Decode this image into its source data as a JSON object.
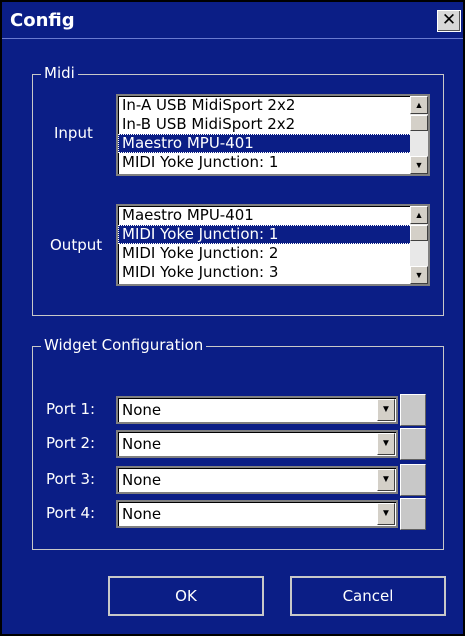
{
  "window": {
    "title": "Config",
    "close_glyph": "✕"
  },
  "midi": {
    "group_label": "Midi",
    "input_label": "Input",
    "output_label": "Output",
    "input_items": [
      "In-A USB MidiSport 2x2",
      "In-B USB MidiSport 2x2",
      "Maestro MPU-401",
      "MIDI Yoke Junction:  1"
    ],
    "input_selected_index": 2,
    "output_items": [
      "Maestro MPU-401",
      "MIDI Yoke Junction:  1",
      "MIDI Yoke Junction:  2",
      "MIDI Yoke Junction:  3"
    ],
    "output_selected_index": 1
  },
  "widget": {
    "group_label": "Widget Configuration",
    "ports": [
      {
        "label": "Port 1:",
        "value": "None"
      },
      {
        "label": "Port 2:",
        "value": "None"
      },
      {
        "label": "Port 3:",
        "value": "None"
      },
      {
        "label": "Port 4:",
        "value": "None"
      }
    ]
  },
  "buttons": {
    "ok": "OK",
    "cancel": "Cancel"
  },
  "icons": {
    "scroll_up": "up-arrow-icon",
    "scroll_down": "down-arrow-icon",
    "dropdown": "chevron-down-icon"
  },
  "colors": {
    "background": "#0b1e86",
    "selection": "#0b1e86",
    "border": "#c8c8c8"
  }
}
